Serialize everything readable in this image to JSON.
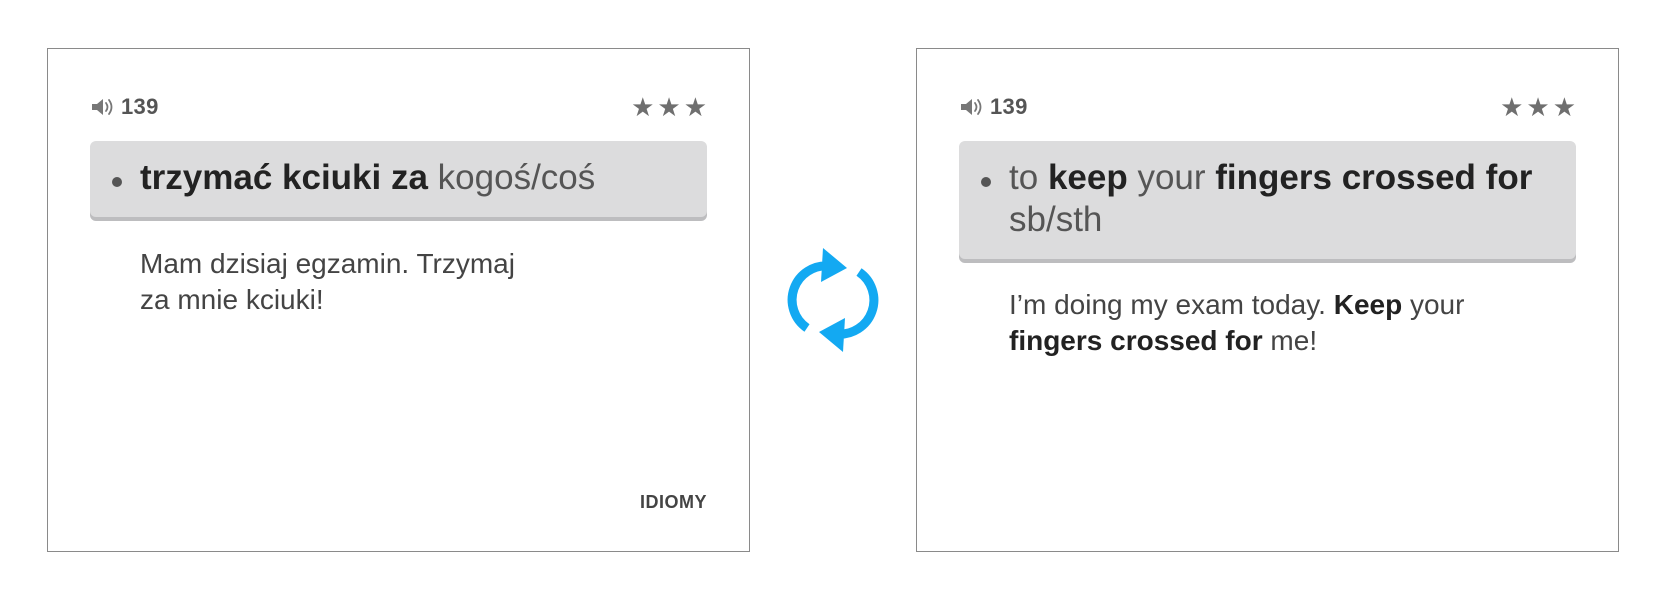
{
  "front": {
    "audio_number": "139",
    "rating_stars": 3,
    "term": {
      "bold_part": "trzymać kciuki za",
      "light_part": "kogoś/coś"
    },
    "example": {
      "line1": "Mam dzisiaj egzamin. Trzymaj",
      "line2": "za mnie kciuki!"
    },
    "category": "IDIOMY"
  },
  "back": {
    "audio_number": "139",
    "rating_stars": 3,
    "term": {
      "part1": "to",
      "part2": "keep",
      "part3": "your",
      "part4": "fingers crossed",
      "part5": "for",
      "part6": "sb/sth"
    },
    "example": {
      "part1": "I’m doing my exam today.",
      "part2": "Keep",
      "part3": "your",
      "part4": "fingers crossed for",
      "part5": "me!"
    }
  },
  "icons": {
    "speaker": "speaker-icon",
    "star": "★",
    "flip": "refresh-icon"
  },
  "colors": {
    "accent": "#13a9f2",
    "term_box_bg": "#dcdcdd",
    "card_border": "#8a8a8a",
    "text_dark": "#222222"
  }
}
